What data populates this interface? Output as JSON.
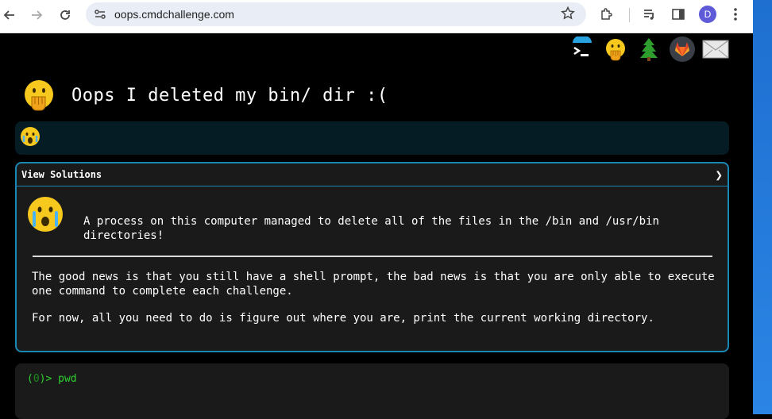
{
  "browser": {
    "url": "oops.cmdchallenge.com",
    "profile_initial": "D"
  },
  "page": {
    "title": "Oops I deleted my bin/ dir :(",
    "view_solutions_label": "View Solutions",
    "chevron": "❯",
    "intro_text": "A process on this computer managed to delete all of the files in the /bin and /usr/bin directories!",
    "para1": "The good news is that you still have a shell prompt, the bad news is that you are only able to execute one command to complete each challenge.",
    "para2": "For now, all you need to do is figure out where you are, print the current working directory."
  },
  "terminal": {
    "prompt_paren_open": "(",
    "prompt_num": "0",
    "prompt_paren_close": ")>",
    "command": "pwd"
  },
  "colors": {
    "accent": "#1b87b5",
    "panel_bg": "#1a1a1a",
    "status_bg": "#051c24",
    "prompt_green": "#2ed12e"
  }
}
